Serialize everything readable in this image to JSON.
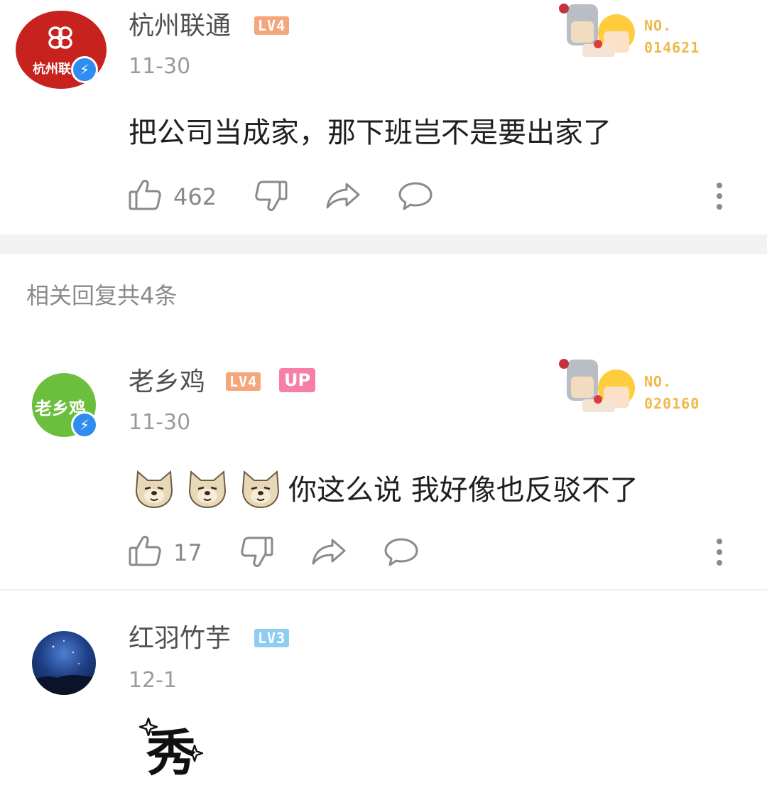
{
  "comment": {
    "username": "杭州联通",
    "level": "LV4",
    "avatar_label": "杭州联",
    "date": "11-30",
    "text": "把公司当成家，那下班岂不是要出家了",
    "likes": "462",
    "badge_no": "NO.",
    "badge_number": "014621"
  },
  "replies_header": "相关回复共4条",
  "replies": [
    {
      "username": "老乡鸡",
      "level": "LV4",
      "up_label": "UP",
      "avatar_label": "老乡鸡",
      "date": "11-30",
      "text": "你这么说 我好像也反驳不了",
      "likes": "17",
      "badge_no": "NO.",
      "badge_number": "020160"
    },
    {
      "username": "红羽竹芋",
      "level": "LV3",
      "date": "12-1",
      "sticker_text": "秀"
    }
  ],
  "colors": {
    "lv4": "#f5a77b",
    "lv3": "#8ecdf2",
    "up": "#f57fa5",
    "verify": "#2f8cf0",
    "avatar_green": "#6bbf3d",
    "avatar_red": "#c8221f"
  }
}
